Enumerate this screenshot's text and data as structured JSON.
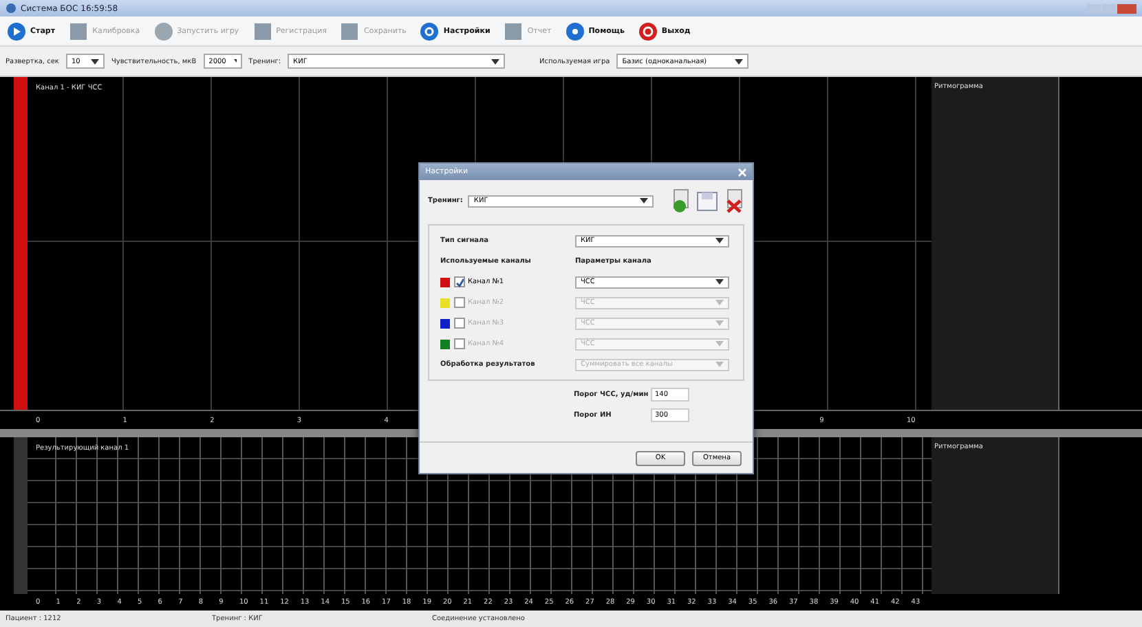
{
  "window": {
    "title": "Система БОС 16:59:58"
  },
  "toolbar": [
    {
      "kind": "play",
      "label": "Старт",
      "disabled": false
    },
    {
      "kind": "square",
      "label": "Калибровка",
      "disabled": true
    },
    {
      "kind": "round",
      "label": "Запустить игру",
      "disabled": true
    },
    {
      "kind": "square",
      "label": "Регистрация",
      "disabled": true
    },
    {
      "kind": "square",
      "label": "Сохранить",
      "disabled": true
    },
    {
      "kind": "gear",
      "label": "Настройки",
      "disabled": false
    },
    {
      "kind": "square",
      "label": "Отчет",
      "disabled": true
    },
    {
      "kind": "help",
      "label": "Помощь",
      "disabled": false
    },
    {
      "kind": "power",
      "label": "Выход",
      "disabled": false
    }
  ],
  "params": [
    {
      "label": "Развертка, сек",
      "value": "10"
    },
    {
      "label": "Чувствительность, мкВ",
      "value": "2000"
    },
    {
      "label": "Тренинг:",
      "value": "КИГ"
    },
    {
      "label": "Используемая игра",
      "value": "Базис (одноканальная)"
    }
  ],
  "top_chart": {
    "label": "Канал 1 - КИГ ЧСС",
    "side_label": "Ритмограмма",
    "ticks": [
      "0",
      "1",
      "2",
      "3",
      "4",
      "9",
      "10"
    ]
  },
  "bottom_chart": {
    "label": "Результирующий канал 1",
    "side_label": "Ритмограмма",
    "ticks": [
      "0",
      "1",
      "2",
      "3",
      "4",
      "5",
      "6",
      "7",
      "8",
      "9",
      "10",
      "11",
      "12",
      "13",
      "14",
      "15",
      "16",
      "17",
      "18",
      "19",
      "20",
      "21",
      "22",
      "23",
      "24",
      "25",
      "26",
      "27",
      "28",
      "29",
      "30",
      "31",
      "32",
      "33",
      "34",
      "35",
      "36",
      "37",
      "38",
      "39",
      "40",
      "41",
      "42",
      "43"
    ]
  },
  "status_bar": [
    "Пациент : 1212",
    "Тренинг : КИГ",
    "Соединение установлено"
  ],
  "dialog": {
    "title": "Настройки",
    "training_label": "Тренинг:",
    "training": "КИГ",
    "signal_label": "Тип сигнала",
    "signal": "КИГ",
    "channels_heading": "Используемые каналы",
    "params_heading": "Параметры канала",
    "channels": [
      {
        "label": "Канал №1",
        "color": "#d01010",
        "checked": true,
        "param": "ЧСС"
      },
      {
        "label": "Канал №2",
        "color": "#e8e020",
        "checked": false,
        "param": "ЧСС"
      },
      {
        "label": "Канал №3",
        "color": "#1020c8",
        "checked": false,
        "param": "ЧСС"
      },
      {
        "label": "Канал №4",
        "color": "#108020",
        "checked": false,
        "param": "ЧСС"
      }
    ],
    "processing_label": "Обработка результатов",
    "processing": "Суммировать все каналы",
    "thresholds": [
      {
        "label": "Порог ЧСС, уд/мин",
        "value": "140"
      },
      {
        "label": "Порог ИН",
        "value": "300"
      }
    ],
    "buttons": [
      "OK",
      "Отмена"
    ]
  }
}
